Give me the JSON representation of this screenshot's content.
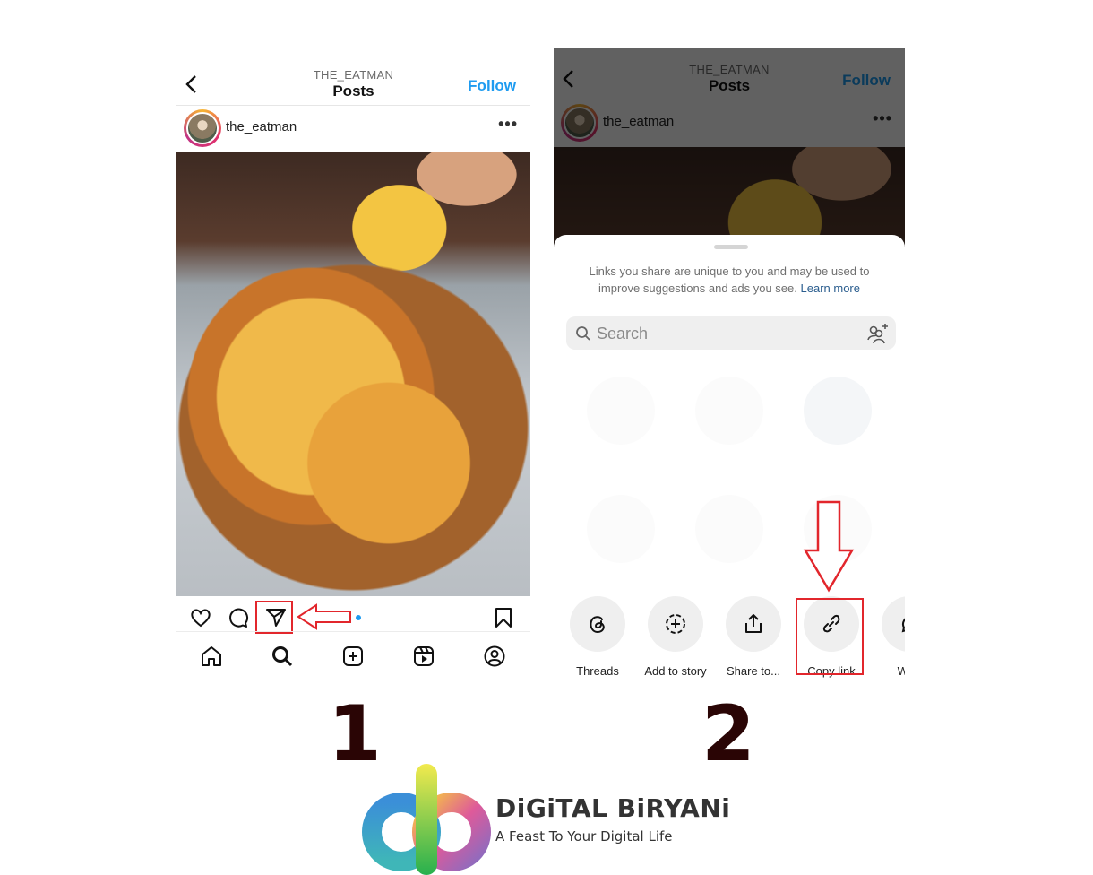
{
  "step1": {
    "header": {
      "subtitle": "THE_EATMAN",
      "title": "Posts",
      "follow_label": "Follow"
    },
    "post": {
      "username": "the_eatman",
      "more_label": "•••"
    },
    "actions": [
      "heart-icon",
      "comment-icon",
      "share-icon",
      "bookmark-icon"
    ],
    "nav": [
      "home-icon",
      "search-icon",
      "create-icon",
      "reels-icon",
      "profile-icon"
    ],
    "step_number": "1"
  },
  "step2": {
    "header": {
      "subtitle": "THE_EATMAN",
      "title": "Posts",
      "follow_label": "Follow"
    },
    "post": {
      "username": "the_eatman",
      "more_label": "•••"
    },
    "sheet": {
      "notice": "Links you share are unique to you and may be used to improve suggestions and ads you see.",
      "learn_more": "Learn more",
      "search_placeholder": "Search"
    },
    "share_options": [
      {
        "label": "Threads",
        "icon": "threads-icon"
      },
      {
        "label": "Add to story",
        "icon": "add-story-icon"
      },
      {
        "label": "Share to...",
        "icon": "share-out-icon"
      },
      {
        "label": "Copy link",
        "icon": "link-icon"
      },
      {
        "label": "Wha",
        "icon": "whatsapp-icon"
      }
    ],
    "step_number": "2"
  },
  "colors": {
    "accent_blue": "#1e9bf0",
    "highlight_red": "#e2262c",
    "step_number": "#2a0505"
  },
  "brand": {
    "name": "DiGiTAL BiRYANi",
    "tagline": "A Feast To Your Digital Life"
  }
}
